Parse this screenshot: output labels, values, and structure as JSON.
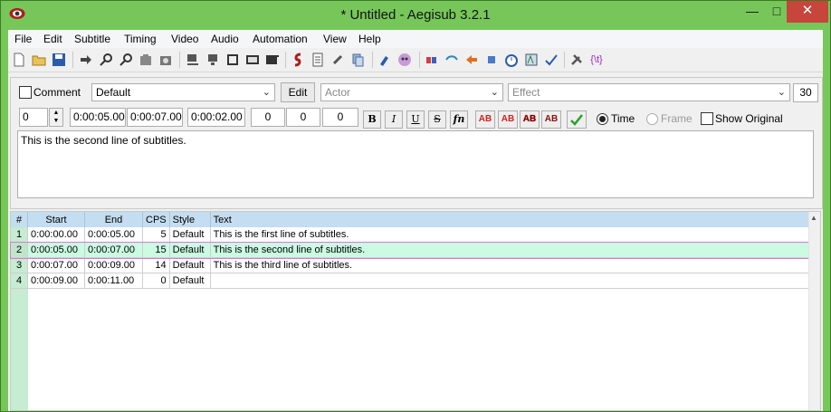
{
  "window": {
    "title": "* Untitled - Aegisub 3.2.1",
    "minimize_icon": "minimize-icon",
    "maximize_icon": "maximize-icon",
    "close_icon": "close-icon"
  },
  "menu": [
    "File",
    "Edit",
    "Subtitle",
    "Timing",
    "Video",
    "Audio",
    "Automation",
    "View",
    "Help"
  ],
  "toolbar_icons": [
    "new-file-icon",
    "open-folder-icon",
    "save-icon",
    "jump-to-icon",
    "zoom-in-icon",
    "zoom-out-icon",
    "snapshot-icon",
    "snapshot-copy-icon",
    "video-details-icon",
    "video-snap-icon",
    "keyframe-icon",
    "aspect-icon",
    "video-play-icon",
    "styles-manager-icon",
    "properties-icon",
    "attachments-icon",
    "fonts-collector-icon",
    "automation-icon",
    "assistant-icon",
    "timing-icon",
    "shift-times-icon",
    "resample-icon",
    "stop-icon",
    "clock-icon",
    "translate-icon",
    "spell-check-icon",
    "options-icon",
    "tags-icon"
  ],
  "editor": {
    "comment_label": "Comment",
    "style_value": "Default",
    "edit_button": "Edit",
    "actor_placeholder": "Actor",
    "effect_placeholder": "Effect",
    "font_size": "30",
    "layer": "0",
    "start_time": "0:00:05.00",
    "end_time": "0:00:07.00",
    "duration": "0:00:02.00",
    "margin_left": "0",
    "margin_right": "0",
    "margin_vertical": "0",
    "bold": "B",
    "italic": "I",
    "underline": "U",
    "strikeout": "S",
    "font_button": "fn",
    "color_buttons": [
      "AB",
      "AB",
      "AB",
      "AB"
    ],
    "commit_icon": "checkmark-icon",
    "time_label": "Time",
    "frame_label": "Frame",
    "show_original_label": "Show Original",
    "text": "This is the second line of subtitles."
  },
  "grid": {
    "headers": [
      "#",
      "Start",
      "End",
      "CPS",
      "Style",
      "Text"
    ],
    "rows": [
      {
        "n": "1",
        "start": "0:00:00.00",
        "end": "0:00:05.00",
        "cps": "5",
        "style": "Default",
        "text": "This is the first line of subtitles."
      },
      {
        "n": "2",
        "start": "0:00:05.00",
        "end": "0:00:07.00",
        "cps": "15",
        "style": "Default",
        "text": "This is the second line of subtitles."
      },
      {
        "n": "3",
        "start": "0:00:07.00",
        "end": "0:00:09.00",
        "cps": "14",
        "style": "Default",
        "text": "This is the third line of subtitles."
      },
      {
        "n": "4",
        "start": "0:00:09.00",
        "end": "0:00:11.00",
        "cps": "0",
        "style": "Default",
        "text": ""
      }
    ]
  }
}
